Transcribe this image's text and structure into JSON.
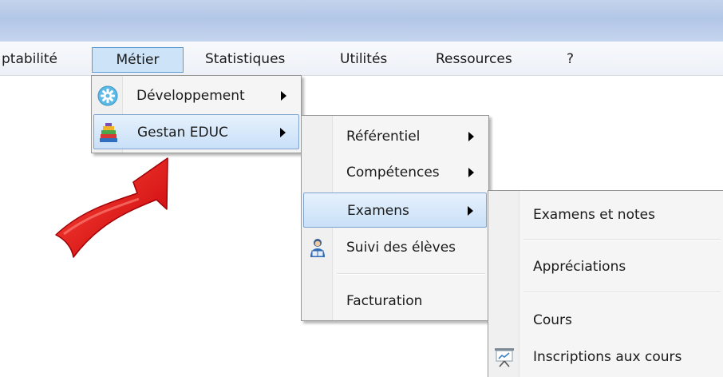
{
  "menubar": {
    "items": [
      {
        "label": "ptabilité"
      },
      {
        "label": "Métier"
      },
      {
        "label": "Statistiques"
      },
      {
        "label": "Utilités"
      },
      {
        "label": "Ressources"
      },
      {
        "label": "?"
      }
    ]
  },
  "metier_menu": {
    "items": [
      {
        "label": "Développement",
        "icon": "gear-icon"
      },
      {
        "label": "Gestan EDUC",
        "icon": "books-icon"
      }
    ]
  },
  "gestan_menu": {
    "items": [
      {
        "label": "Référentiel"
      },
      {
        "label": "Compétences"
      },
      {
        "label": "Examens"
      },
      {
        "label": "Suivi des élèves",
        "icon": "student-reading-icon"
      },
      {
        "label": "Facturation"
      }
    ]
  },
  "examens_menu": {
    "items": [
      {
        "label": "Examens et notes"
      },
      {
        "label": "Appréciations"
      },
      {
        "label": "Cours"
      },
      {
        "label": "Inscriptions aux cours",
        "icon": "presentation-board-icon"
      }
    ]
  },
  "colors": {
    "highlight": "#cde4f8",
    "highlight_border": "#5b9bd5",
    "pointer_arrow": "#e8141b"
  }
}
